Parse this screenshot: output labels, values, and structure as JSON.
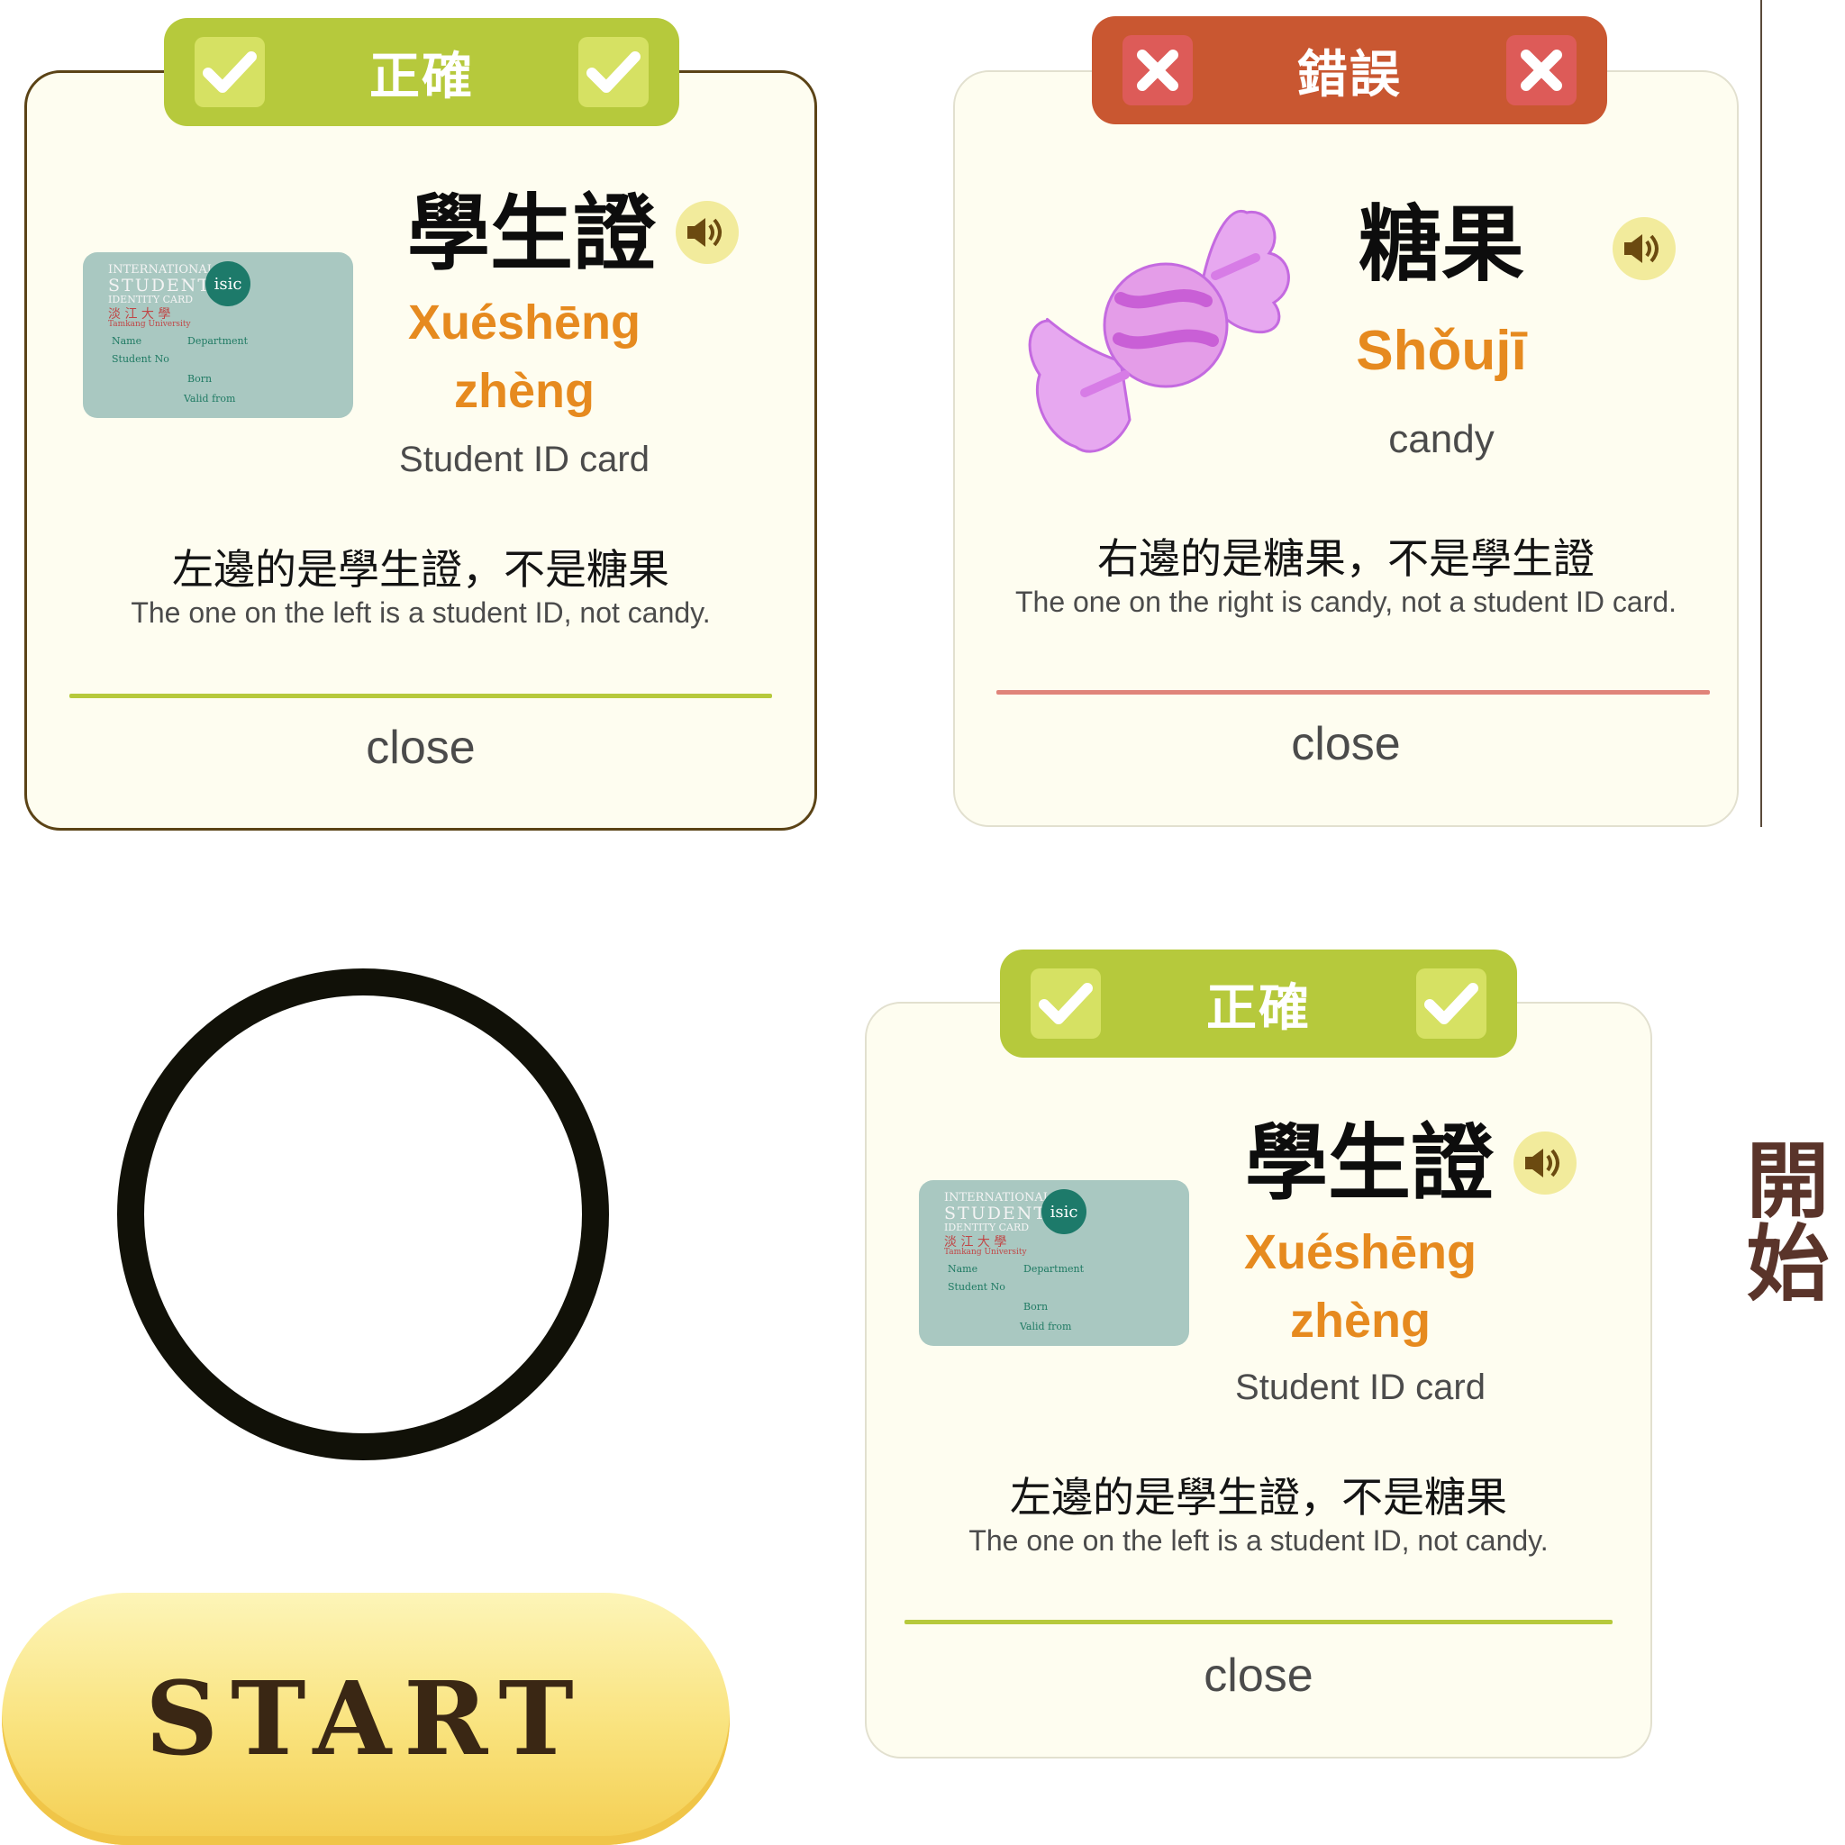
{
  "colors": {
    "correct_green": "#b6c93c",
    "wrong_red": "#c95731",
    "pinyin_orange": "#e68a1f",
    "card_bg": "#fefdf0",
    "start_text": "#3a2714",
    "vertical_start": "#5a342a"
  },
  "card_correct_1": {
    "banner": "正確",
    "banner_icon": "check-icon",
    "hanzi": "學生證",
    "pinyin_1": "Xuéshēng",
    "pinyin_2": "zhèng",
    "meaning": "Student ID card",
    "sentence_zh": "左邊的是學生證，不是糖果",
    "sentence_en": "The one on the left is a student ID, not candy.",
    "close": "close",
    "image": "student-id-card"
  },
  "card_wrong": {
    "banner": "錯誤",
    "banner_icon": "cross-icon",
    "hanzi": "糖果",
    "pinyin": "Shǒujī",
    "meaning": "candy",
    "sentence_zh": "右邊的是糖果，不是學生證",
    "sentence_en": "The one on the right is candy, not a student ID card.",
    "close": "close",
    "image": "candy"
  },
  "card_correct_2": {
    "banner": "正確",
    "banner_icon": "check-icon",
    "hanzi": "學生證",
    "pinyin_1": "Xuéshēng",
    "pinyin_2": "zhèng",
    "meaning": "Student ID card",
    "sentence_zh": "左邊的是學生證，不是糖果",
    "sentence_en": "The one on the left is a student ID, not candy.",
    "close": "close",
    "image": "student-id-card"
  },
  "id_card": {
    "line1": "INTERNATIONAL",
    "line2": "STUDENT",
    "line3": "IDENTITY CARD",
    "line4": "淡 江 大 學",
    "line5": "Tamkang University",
    "name": "Name",
    "department": "Department",
    "student_no": "Student No",
    "born": "Born",
    "valid": "Valid from",
    "logo": "isic"
  },
  "start_button": {
    "label": "START"
  },
  "vertical_start": {
    "label": "開始"
  }
}
